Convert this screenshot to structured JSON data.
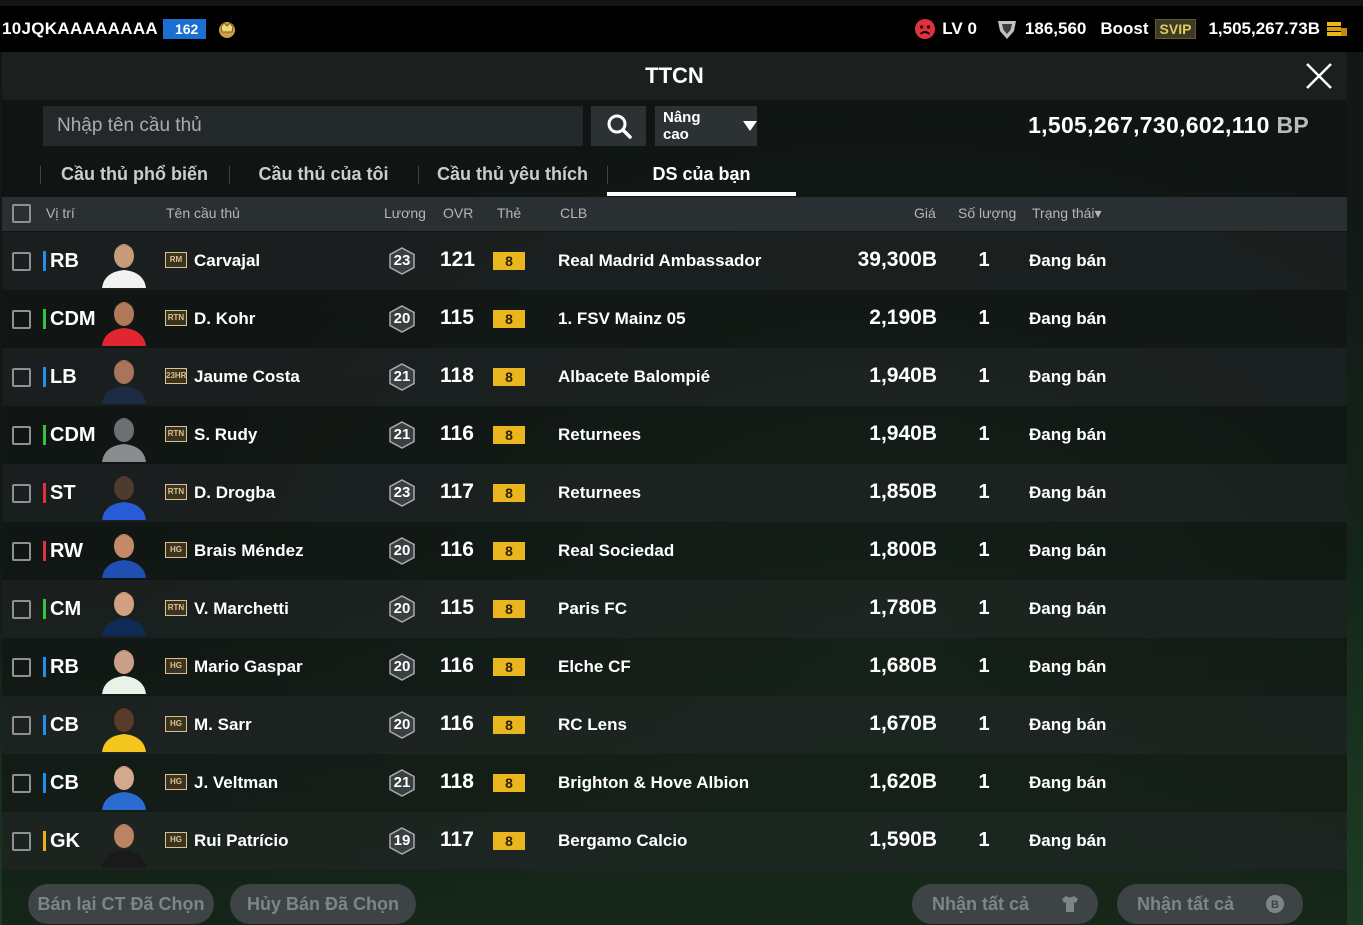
{
  "topbar": {
    "username": "10JQKAAAAAAAA",
    "level": "162",
    "lv": "LV 0",
    "points": "186,560",
    "boost": "Boost",
    "svip": "SVIP",
    "money": "1,505,267.73B"
  },
  "window": {
    "title": "TTCN"
  },
  "search": {
    "placeholder": "Nhập tên cầu thủ",
    "advanced_label": "Nâng cao"
  },
  "balance": {
    "value": "1,505,267,730,602,110",
    "unit": "BP"
  },
  "tabs": [
    {
      "label": "Cầu thủ phổ biến"
    },
    {
      "label": "Cầu thủ của tôi"
    },
    {
      "label": "Cầu thủ yêu thích"
    },
    {
      "label": "DS của bạn"
    }
  ],
  "columns": {
    "position": "Vị trí",
    "name": "Tên cầu thủ",
    "salary": "Lương",
    "ovr": "OVR",
    "card": "Thẻ",
    "club": "CLB",
    "price": "Giá",
    "quantity": "Số lượng",
    "status": "Trạng thái▾"
  },
  "colors": {
    "pos_def": "#1f8ff0",
    "pos_mid": "#35c33f",
    "pos_att": "#e0323a",
    "grade": "#e9b61d"
  },
  "rows": [
    {
      "pos": "RB",
      "pos_color": "#1f8ff0",
      "card": "RM",
      "name": "Carvajal",
      "salary": "23",
      "ovr": "121",
      "grade": "8",
      "club": "Real Madrid Ambassador",
      "price": "39,300B",
      "qty": "1",
      "status": "Đang bán"
    },
    {
      "pos": "CDM",
      "pos_color": "#35c33f",
      "card": "RTN",
      "name": "D. Kohr",
      "salary": "20",
      "ovr": "115",
      "grade": "8",
      "club": "1. FSV Mainz 05",
      "price": "2,190B",
      "qty": "1",
      "status": "Đang bán"
    },
    {
      "pos": "LB",
      "pos_color": "#1f8ff0",
      "card": "23HR",
      "name": "Jaume Costa",
      "salary": "21",
      "ovr": "118",
      "grade": "8",
      "club": "Albacete Balompié",
      "price": "1,940B",
      "qty": "1",
      "status": "Đang bán"
    },
    {
      "pos": "CDM",
      "pos_color": "#35c33f",
      "card": "RTN",
      "name": "S. Rudy",
      "salary": "21",
      "ovr": "116",
      "grade": "8",
      "club": "Returnees",
      "price": "1,940B",
      "qty": "1",
      "status": "Đang bán"
    },
    {
      "pos": "ST",
      "pos_color": "#e0323a",
      "card": "RTN",
      "name": "D. Drogba",
      "salary": "23",
      "ovr": "117",
      "grade": "8",
      "club": "Returnees",
      "price": "1,850B",
      "qty": "1",
      "status": "Đang bán"
    },
    {
      "pos": "RW",
      "pos_color": "#e0323a",
      "card": "HG",
      "name": "Brais Méndez",
      "salary": "20",
      "ovr": "116",
      "grade": "8",
      "club": "Real Sociedad",
      "price": "1,800B",
      "qty": "1",
      "status": "Đang bán"
    },
    {
      "pos": "CM",
      "pos_color": "#35c33f",
      "card": "RTN",
      "name": "V. Marchetti",
      "salary": "20",
      "ovr": "115",
      "grade": "8",
      "club": "Paris FC",
      "price": "1,780B",
      "qty": "1",
      "status": "Đang bán"
    },
    {
      "pos": "RB",
      "pos_color": "#1f8ff0",
      "card": "HG",
      "name": "Mario Gaspar",
      "salary": "20",
      "ovr": "116",
      "grade": "8",
      "club": "Elche CF",
      "price": "1,680B",
      "qty": "1",
      "status": "Đang bán"
    },
    {
      "pos": "CB",
      "pos_color": "#1f8ff0",
      "card": "HG",
      "name": "M. Sarr",
      "salary": "20",
      "ovr": "116",
      "grade": "8",
      "club": "RC Lens",
      "price": "1,670B",
      "qty": "1",
      "status": "Đang bán"
    },
    {
      "pos": "CB",
      "pos_color": "#1f8ff0",
      "card": "HG",
      "name": "J. Veltman",
      "salary": "21",
      "ovr": "118",
      "grade": "8",
      "club": "Brighton & Hove Albion",
      "price": "1,620B",
      "qty": "1",
      "status": "Đang bán"
    },
    {
      "pos": "GK",
      "pos_color": "#e8b21a",
      "card": "HG",
      "name": "Rui Patrício",
      "salary": "19",
      "ovr": "117",
      "grade": "8",
      "club": "Bergamo Calcio",
      "price": "1,590B",
      "qty": "1",
      "status": "Đang bán"
    }
  ],
  "bottom": {
    "resell": "Bán lại CT Đã Chọn",
    "cancel": "Hủy Bán Đã Chọn",
    "claim_players": "Nhận tất cả",
    "claim_coins": "Nhận tất cả"
  }
}
